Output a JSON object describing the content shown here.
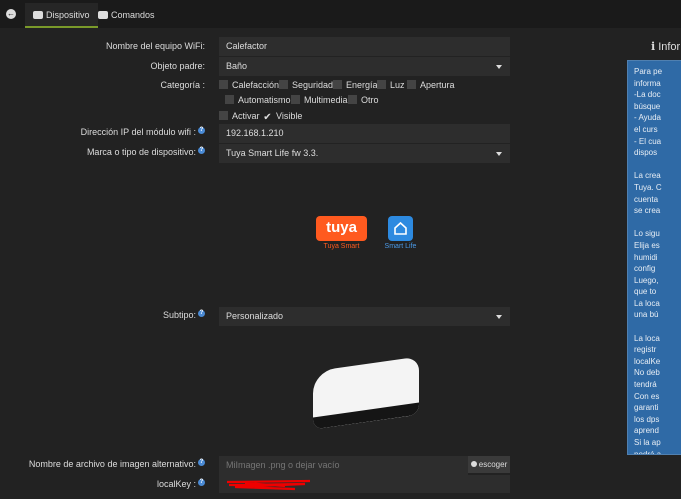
{
  "tabs": {
    "dispositivo": "Dispositivo",
    "comandos": "Comandos"
  },
  "form": {
    "wifi_name_label": "Nombre del equipo WiFi:",
    "wifi_name": "Calefactor",
    "parent_label": "Objeto padre:",
    "parent": "Baño",
    "category_label": "Categoría :",
    "categories": [
      "Calefacción",
      "Seguridad",
      "Energía",
      "Luz",
      "Apertura",
      "Automatismo",
      "Multimedia",
      "Otro"
    ],
    "activar": "Activar",
    "visible": "Visible",
    "visible_checked": true,
    "activar_checked": false,
    "ip_label": "Dirección IP del módulo wifi :",
    "ip": "192.168.1.210",
    "brand_label": "Marca o tipo de dispositivo:",
    "brand": "Tuya Smart Life fw 3.3.",
    "subtype_label": "Subtipo:",
    "subtype": "Personalizado",
    "alt_image_label": "Nombre de archivo de imagen alternativo:",
    "alt_image_placeholder": "MiImagen .png o dejar vacío",
    "choose": "escoger",
    "localkey_label": "localKey :"
  },
  "logos": {
    "tuya": "tuya",
    "tuya_caption": "Tuya Smart",
    "smartlife_caption": "Smart Life"
  },
  "info": {
    "title": "Infor",
    "lines": [
      "Para pe",
      "informa",
      "-La doc",
      "búsque",
      "- Ayuda",
      "el curs",
      "- El cua",
      "dispos",
      "",
      "La crea",
      "Tuya. C",
      "cuenta",
      "se crea",
      "",
      "Lo sigu",
      "Elija es",
      "humidi",
      "config",
      "Luego,",
      "que to",
      "La loca",
      "una bú",
      "",
      "La loca",
      "registr",
      "localKe",
      "No deb",
      "tendrá",
      "Con es",
      "garanti",
      "los dps",
      "aprend",
      "Si la ap",
      "podrá a"
    ]
  },
  "colors": {
    "tab_active_underline": "#7a9a2a",
    "info_bg": "#2f6aa6",
    "tuya": "#ff5a1f",
    "smartlife": "#2d8ae0"
  }
}
